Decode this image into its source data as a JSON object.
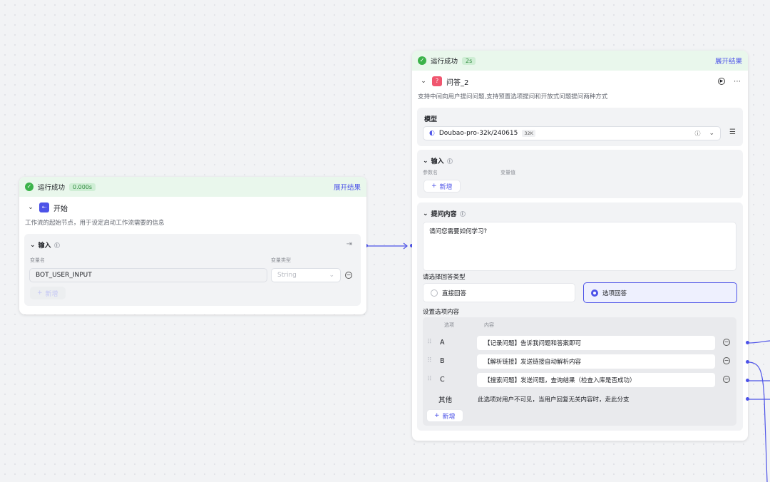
{
  "start_node": {
    "status_text": "运行成功",
    "duration": "0.000s",
    "expand_label": "展开结果",
    "title": "开始",
    "description": "工作流的起始节点，用于设定启动工作流需要的信息",
    "input_section": {
      "title": "输入",
      "col_name": "变量名",
      "col_type": "变量类型",
      "var_name": "BOT_USER_INPUT",
      "var_type": "String",
      "add_label": "新增"
    }
  },
  "qa_node": {
    "status_text": "运行成功",
    "duration": "2s",
    "expand_label": "展开结果",
    "title": "问答_2",
    "description": "支持中间向用户提问问题,支持预置选项提问和开放式问题提问两种方式",
    "model_section": {
      "title": "模型",
      "model_name": "Doubao-pro-32k/240615",
      "model_badge": "32K"
    },
    "input_section": {
      "title": "输入",
      "col_param": "参数名",
      "col_value": "变量值",
      "add_label": "新增"
    },
    "question_section": {
      "title": "提问内容",
      "content": "请问您需要如何学习?",
      "answer_type_label": "请选择回答类型",
      "answer_types": [
        "直接回答",
        "选项回答"
      ],
      "selected_answer_type": "选项回答",
      "options_label": "设置选项内容",
      "col_option": "选项",
      "col_content": "内容",
      "options": [
        {
          "key": "A",
          "content": "【记录问题】告诉我问题和答案即可"
        },
        {
          "key": "B",
          "content": "【解析链接】发送链接自动解析内容"
        },
        {
          "key": "C",
          "content": "【搜索问题】发送问题，查询结果（检查入库是否成功）"
        }
      ],
      "other_key": "其他",
      "other_content": "此选项对用户不可见，当用户回复无关内容时，走此分支",
      "add_label": "新增"
    }
  },
  "colors": {
    "accent": "#4d53e8",
    "success": "#3bb34a",
    "start_icon": "#4d53e8",
    "qa_icon": "#f0566f"
  }
}
